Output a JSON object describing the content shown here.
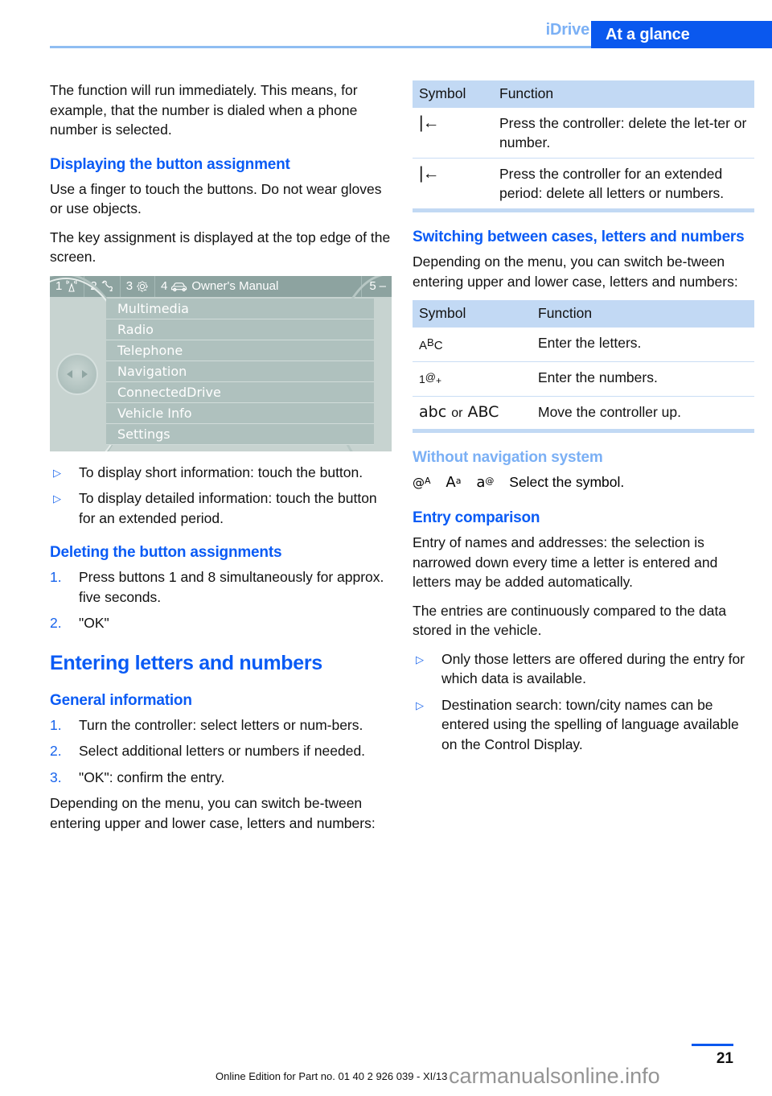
{
  "header": {
    "chapter": "iDrive",
    "section": "At a glance"
  },
  "left_column": {
    "intro_paragraph": "The function will run immediately. This means, for example, that the number is dialed when a phone number is selected.",
    "displaying_heading": "Displaying the button assignment",
    "displaying_p1": "Use a finger to touch the buttons. Do not wear gloves or use objects.",
    "displaying_p2": "The key assignment is displayed at the top edge of the screen.",
    "idrive_screen": {
      "topbar": [
        {
          "number": "1",
          "icon": "radio-tower-icon",
          "label": ""
        },
        {
          "number": "2",
          "icon": "phone-handset-icon",
          "label": ""
        },
        {
          "number": "3",
          "icon": "gear-icon",
          "label": ""
        },
        {
          "number": "4",
          "icon": "car-icon",
          "label": "Owner's Manual"
        },
        {
          "number": "5",
          "icon": "dash-icon",
          "label": "–"
        }
      ],
      "menu_items": [
        "Multimedia",
        "Radio",
        "Telephone",
        "Navigation",
        "ConnectedDrive",
        "Vehicle Info",
        "Settings"
      ]
    },
    "touch_bullets": [
      "To display short information: touch the button.",
      "To display detailed information: touch the button for an extended period."
    ],
    "deleting_heading": "Deleting the button assignments",
    "deleting_steps": [
      {
        "num": "1.",
        "text": "Press buttons 1 and 8 simultaneously for approx. five seconds."
      },
      {
        "num": "2.",
        "text": "\"OK\""
      }
    ],
    "entering_heading": "Entering letters and numbers",
    "general_heading": "General information",
    "general_steps": [
      {
        "num": "1.",
        "text": "Turn the controller: select letters or num‐bers."
      },
      {
        "num": "2.",
        "text": "Select additional letters or numbers if needed."
      },
      {
        "num": "3.",
        "text": "\"OK\": confirm the entry."
      }
    ],
    "closing_paragraph": "Depending on the menu, you can switch be‐tween entering upper and lower case, letters and numbers:"
  },
  "right_column": {
    "table_delete": {
      "headers": [
        "Symbol",
        "Function"
      ],
      "rows": [
        {
          "symbol": "backspace-icon",
          "symbol_text": "|←",
          "function": "Press the controller: delete the let‐ter or number."
        },
        {
          "symbol": "backspace-icon",
          "symbol_text": "|←",
          "function": "Press the controller for an extended period: delete all letters or numbers."
        }
      ]
    },
    "switching_heading": "Switching between cases, letters and numbers",
    "switching_paragraph": "Depending on the menu, you can switch be‐tween entering upper and lower case, letters and numbers:",
    "table_switching": {
      "headers": [
        "Symbol",
        "Function"
      ],
      "rows": [
        {
          "symbol": "letters-abc-icon",
          "symbol_text": "AᴮC",
          "function": "Enter the letters."
        },
        {
          "symbol": "numbers-icon",
          "symbol_text": "1@+",
          "function": "Enter the numbers."
        },
        {
          "symbol": "case-toggle-icon",
          "symbol_text": "abc or ABC",
          "function": "Move the controller up."
        }
      ]
    },
    "without_nav_heading": "Without navigation system",
    "without_nav_symbols": [
      "@ᴬ",
      "Aᵃ",
      "a@"
    ],
    "without_nav_text": "Select the symbol.",
    "entry_comparison_heading": "Entry comparison",
    "entry_p1": "Entry of names and addresses: the selection is narrowed down every time a letter is entered and letters may be added automatically.",
    "entry_p2": "The entries are continuously compared to the data stored in the vehicle.",
    "entry_bullets": [
      "Only those letters are offered during the entry for which data is available.",
      "Destination search: town/city names can be entered using the spelling of language available on the Control Display."
    ]
  },
  "footer": {
    "page_number": "21",
    "edition": "Online Edition for Part no. 01 40 2 926 039 - XI/13",
    "watermark": "carmanualsonline.info"
  },
  "colors": {
    "banner_blue": "#0A58EE",
    "heading_blue": "#0A5BF5",
    "light_blue": "#7BB0F5",
    "table_header_blue": "#C2D9F4",
    "screen_bg": "#C7D3D0",
    "screen_topbar": "#8DA3A0"
  }
}
